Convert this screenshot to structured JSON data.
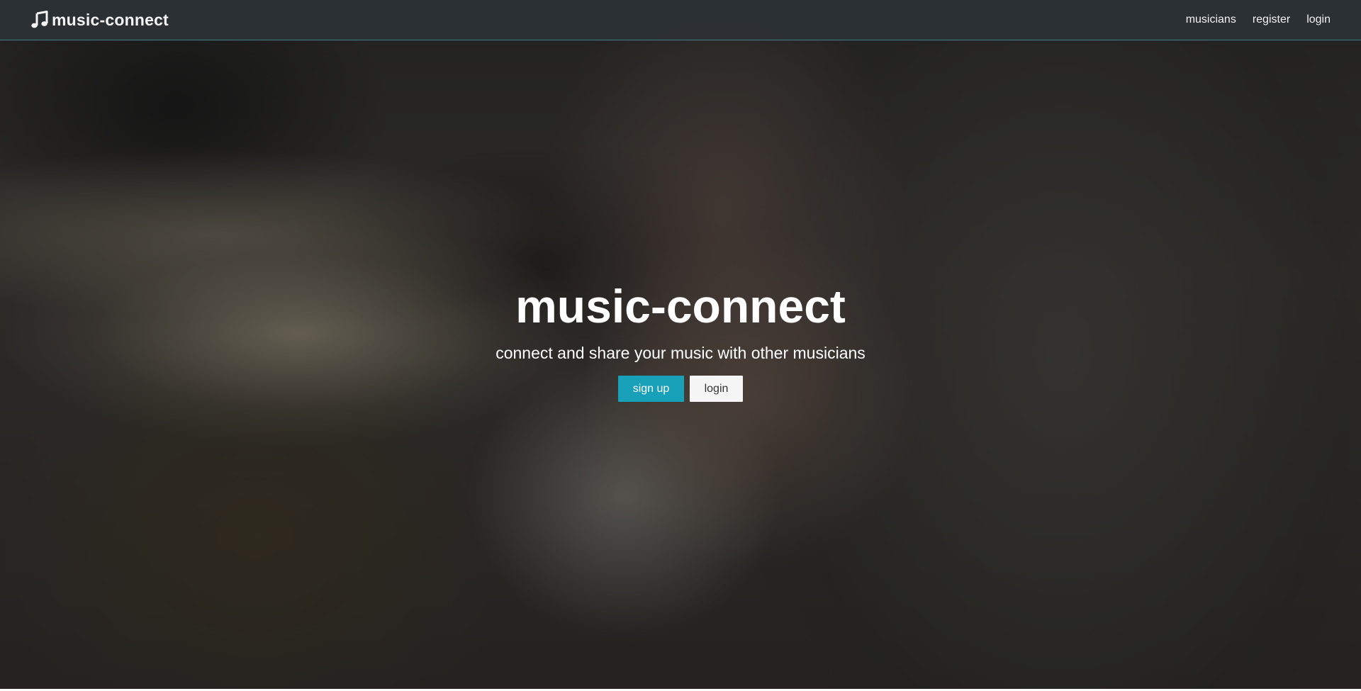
{
  "navbar": {
    "brand": {
      "icon": "music-note-icon",
      "text": "music-connect"
    },
    "links": [
      {
        "label": "musicians"
      },
      {
        "label": "register"
      },
      {
        "label": "login"
      }
    ],
    "colors": {
      "background": "#2c3136",
      "border": "#3e7e86"
    }
  },
  "hero": {
    "title": "music-connect",
    "subtitle": "connect and share your music with other musicians",
    "buttons": {
      "signup_label": "sign up",
      "login_label": "login"
    },
    "colors": {
      "primary_button": "#17a0b8",
      "default_button": "#f5f5f5"
    }
  }
}
